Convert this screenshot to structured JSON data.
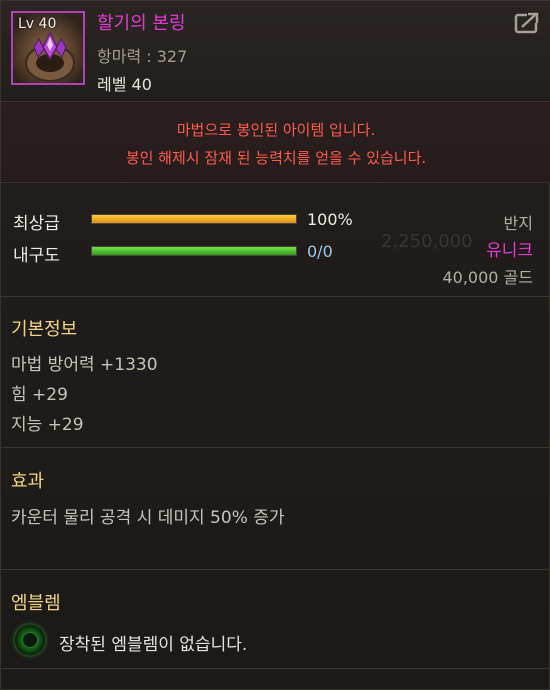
{
  "item": {
    "level_badge": "Lv 40",
    "name": "할기의 본링",
    "subtitle": "항마력 : 327",
    "level_text": "레벨 40",
    "icon": "ring-icon",
    "name_color": "#e63ad6"
  },
  "seal": {
    "line1": "마법으로 봉인된 아이템 입니다.",
    "line2": "봉인 해제시 잠재 된 능력치를 얻을 수 있습니다."
  },
  "bars": {
    "grade_label": "최상급",
    "grade_value": "100%",
    "grade_fraction": 1.0,
    "durability_label": "내구도",
    "durability_value": "0/0",
    "durability_fraction": 1.0
  },
  "info": {
    "type": "반지",
    "rarity": "유니크",
    "rarity_color": "#e63ad6",
    "price": "40,000 골드",
    "faded_price": "2,250,000"
  },
  "basic": {
    "title": "기본정보",
    "lines": [
      "마법 방어력 +1330",
      "힘 +29",
      "지능 +29"
    ]
  },
  "effect": {
    "title": "효과",
    "line": "카운터 물리 공격 시 데미지 50% 증가"
  },
  "emblem": {
    "title": "엠블렘",
    "empty_text": "장착된 엠블렘이 없습니다."
  }
}
